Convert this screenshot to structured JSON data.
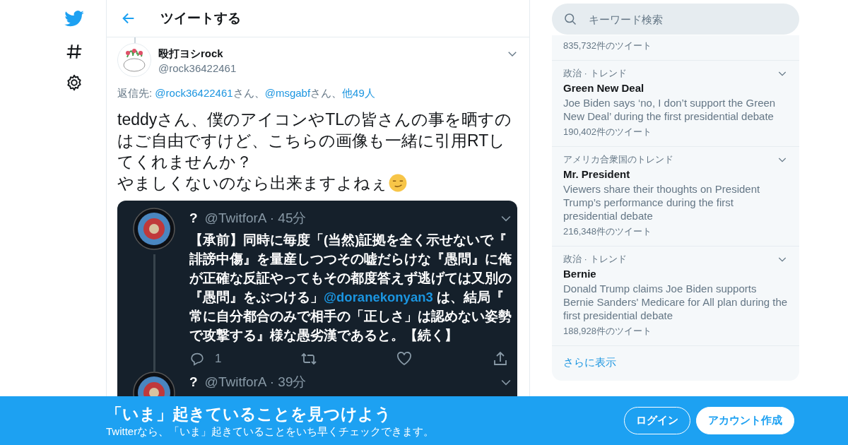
{
  "header": {
    "title": "ツイートする"
  },
  "tweet": {
    "name": "殴打ヨシrock",
    "handle": "@rock36422461",
    "reply_label": "返信先:",
    "reply_to": [
      {
        "kind": "link",
        "text": "@rock36422461"
      },
      {
        "kind": "plain",
        "text": "さん、"
      },
      {
        "kind": "link",
        "text": "@msgabf"
      },
      {
        "kind": "plain",
        "text": "さん、"
      },
      {
        "kind": "link",
        "text": "他49人"
      }
    ],
    "text_lines": [
      "teddyさん、僕のアイコンやTLの皆さんの事を晒すのはご自由ですけど、こちらの画像も一緒に引用RTしてくれませんか？",
      "やましくないのなら出来ますよねぇ"
    ],
    "image": {
      "tweets": [
        {
          "name": "?",
          "handle": "@TwitforA · 45分",
          "text_before": "【承前】同時に毎度「(当然)証拠を全く示せないで『誹謗中傷』を量産しつつその嘘だらけな『愚問』に俺が正確な反証やってもその都度答えず逃げては又別の『愚問』をぶつける」",
          "mention": "@doranekonyan3",
          "text_after": " は、結局『常に自分都合のみで相手の「正しさ」は認めない姿勢で攻撃する』様な愚劣漢であると。【続く】",
          "reply_count": "1"
        },
        {
          "name": "?",
          "handle": "@TwitforA · 39分"
        }
      ]
    }
  },
  "search": {
    "placeholder": "キーワード検索"
  },
  "trends": [
    {
      "count": "835,732件のツイート"
    },
    {
      "category": "政治 · トレンド",
      "title": "Green New Deal",
      "description": "Joe Biden says ‘no, I don’t support the Green New Deal’ during the first presidential debate",
      "count": "190,402件のツイート"
    },
    {
      "category": "アメリカ合衆国のトレンド",
      "title": "Mr. President",
      "description": "Viewers share their thoughts on President Trump’s performance during the first presidential debate",
      "count": "216,348件のツイート"
    },
    {
      "category": "政治 · トレンド",
      "title": "Bernie",
      "description": "Donald Trump claims Joe Biden supports Bernie Sanders' Medicare for All plan during the first presidential debate",
      "count": "188,928件のツイート"
    }
  ],
  "show_more": "さらに表示",
  "banner": {
    "title": "「いま」起きていることを見つけよう",
    "subtitle": "Twitterなら、「いま」起きていることをいち早くチェックできます。",
    "buttons": [
      {
        "kind": "outline",
        "label": "ログイン"
      },
      {
        "kind": "solid",
        "label": "アカウント作成"
      }
    ]
  }
}
